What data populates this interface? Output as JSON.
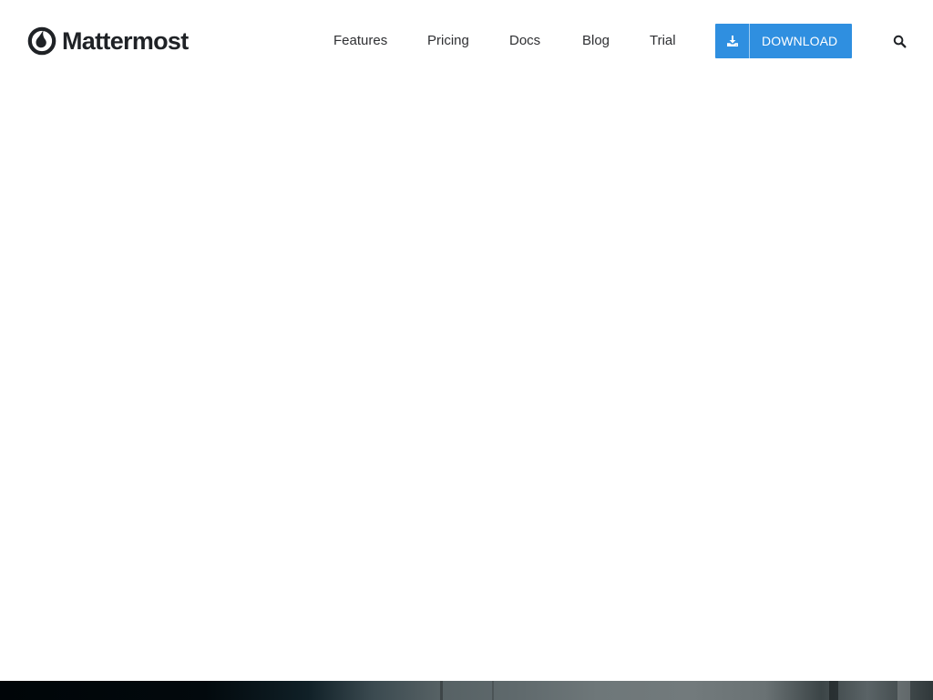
{
  "brand": {
    "name": "Mattermost",
    "logo_icon": "mattermost-logo-icon"
  },
  "nav": {
    "items": [
      {
        "label": "Features"
      },
      {
        "label": "Pricing"
      },
      {
        "label": "Docs"
      },
      {
        "label": "Blog"
      },
      {
        "label": "Trial"
      }
    ],
    "download": {
      "label": "DOWNLOAD",
      "icon": "download-icon",
      "color": "#2f8fe0"
    },
    "search": {
      "icon": "search-icon",
      "label": "Search"
    }
  },
  "hero": {
    "background": "dark-photo-strip"
  },
  "colors": {
    "text": "#2f3033",
    "brand_text": "#1f2226",
    "accent": "#2f8fe0",
    "background": "#ffffff"
  }
}
